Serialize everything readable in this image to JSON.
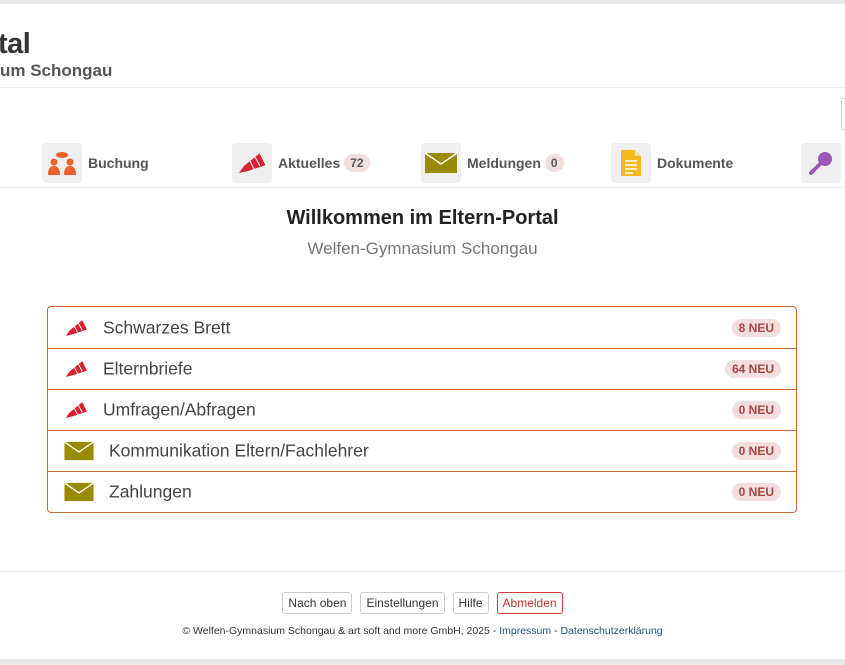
{
  "brand": {
    "title": "tal",
    "subtitle": "um Schongau"
  },
  "nav": {
    "items": [
      {
        "label": "Buchung",
        "icon": "people-icon",
        "badge": ""
      },
      {
        "label": "Aktuelles",
        "icon": "megaphone-icon",
        "badge": "72"
      },
      {
        "label": "Meldungen",
        "icon": "envelope-icon",
        "badge": "0"
      },
      {
        "label": "Dokumente",
        "icon": "document-icon",
        "badge": ""
      },
      {
        "label": "",
        "icon": "magnifier-icon",
        "badge": ""
      }
    ]
  },
  "main": {
    "welcome": "Willkommen im Eltern-Portal",
    "school": "Welfen-Gymnasium Schongau",
    "items": [
      {
        "label": "Schwarzes Brett",
        "icon": "megaphone-icon",
        "badge": "8 NEU"
      },
      {
        "label": "Elternbriefe",
        "icon": "megaphone-icon",
        "badge": "64 NEU"
      },
      {
        "label": "Umfragen/Abfragen",
        "icon": "megaphone-icon",
        "badge": "0 NEU"
      },
      {
        "label": "Kommunikation Eltern/Fachlehrer",
        "icon": "envelope-icon",
        "badge": "0 NEU"
      },
      {
        "label": "Zahlungen",
        "icon": "envelope-icon",
        "badge": "0 NEU"
      }
    ]
  },
  "footer": {
    "top_label": "Nach oben",
    "settings_label": "Einstellungen",
    "help_label": "Hilfe",
    "logout_label": "Abmelden",
    "copyright": "© Welfen-Gymnasium Schongau & art soft and more GmbH, 2025 -",
    "impressum": "Impressum",
    "separator": "-",
    "privacy": "Datenschutzerklärung"
  },
  "colors": {
    "accent_border": "#c86b38",
    "megaphone": "#d9222f",
    "envelope": "#9a8a00",
    "people": "#e8622a",
    "document": "#f5b820",
    "magnifier": "#9b59b6",
    "badge_bg": "#f2dede",
    "badge_text": "#a94442"
  }
}
